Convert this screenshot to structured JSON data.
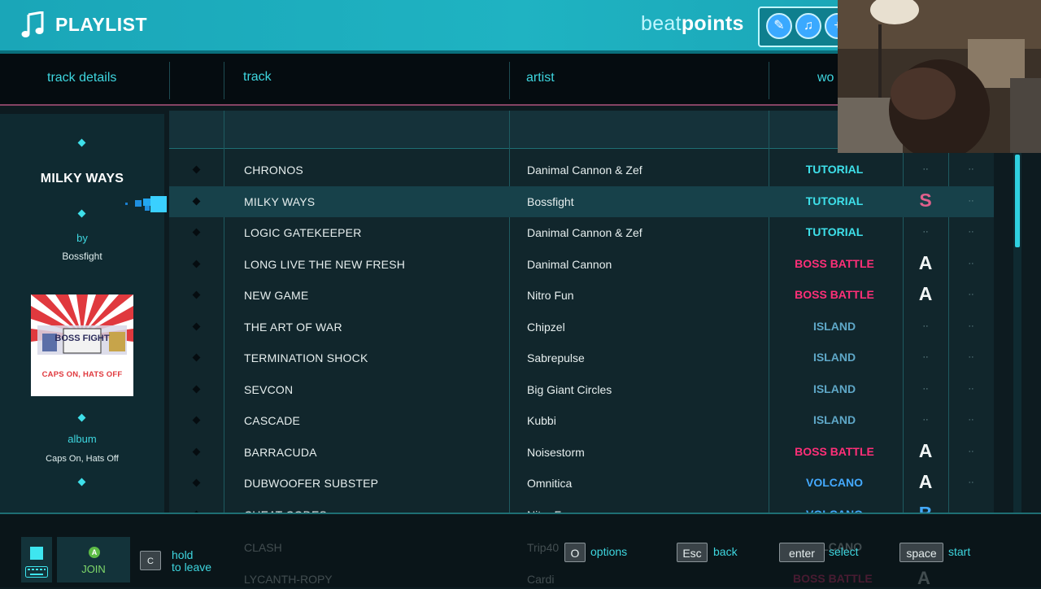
{
  "header": {
    "title": "PLAYLIST",
    "brand_part1": "beat",
    "brand_part2": "points"
  },
  "columns": {
    "track_details": "track details",
    "track": "track",
    "artist": "artist",
    "world": "wo"
  },
  "details": {
    "title": "MILKY WAYS",
    "by_label": "by",
    "artist": "Bossfight",
    "album_label": "album",
    "album": "Caps On, Hats Off",
    "album_art_top": "BOSS FIGHT",
    "album_art_bottom": "CAPS ON, HATS OFF"
  },
  "tracks": [
    {
      "track": "CHRONOS",
      "artist": "Danimal Cannon & Zef",
      "world": "TUTORIAL",
      "world_color": "#3ee0ea",
      "grade": "",
      "selected": false
    },
    {
      "track": "MILKY WAYS",
      "artist": "Bossfight",
      "world": "TUTORIAL",
      "world_color": "#3ee0ea",
      "grade": "S",
      "grade_color": "#e0608c",
      "selected": true
    },
    {
      "track": "LOGIC GATEKEEPER",
      "artist": "Danimal Cannon & Zef",
      "world": "TUTORIAL",
      "world_color": "#3ee0ea",
      "grade": "",
      "selected": false
    },
    {
      "track": "LONG LIVE THE NEW FRESH",
      "artist": "Danimal Cannon",
      "world": "BOSS BATTLE",
      "world_color": "#ff2f78",
      "grade": "A",
      "selected": false
    },
    {
      "track": "NEW GAME",
      "artist": "Nitro Fun",
      "world": "BOSS BATTLE",
      "world_color": "#ff2f78",
      "grade": "A",
      "selected": false
    },
    {
      "track": "THE ART OF WAR",
      "artist": "Chipzel",
      "world": "ISLAND",
      "world_color": "#5fa8c8",
      "grade": "",
      "selected": false
    },
    {
      "track": "TERMINATION SHOCK",
      "artist": "Sabrepulse",
      "world": "ISLAND",
      "world_color": "#5fa8c8",
      "grade": "",
      "selected": false
    },
    {
      "track": "SEVCON",
      "artist": "Big Giant Circles",
      "world": "ISLAND",
      "world_color": "#5fa8c8",
      "grade": "",
      "selected": false
    },
    {
      "track": "CASCADE",
      "artist": "Kubbi",
      "world": "ISLAND",
      "world_color": "#5fa8c8",
      "grade": "",
      "selected": false
    },
    {
      "track": "BARRACUDA",
      "artist": "Noisestorm",
      "world": "BOSS BATTLE",
      "world_color": "#ff2f78",
      "grade": "A",
      "selected": false
    },
    {
      "track": "DUBWOOFER SUBSTEP",
      "artist": "Omnitica",
      "world": "VOLCANO",
      "world_color": "#44aaff",
      "grade": "A",
      "selected": false
    },
    {
      "track": "CHEAT CODES",
      "artist": "Nitro Fun",
      "world": "VOLCANO",
      "world_color": "#44aaff",
      "grade": "B",
      "grade_color": "#44aaff",
      "selected": false
    }
  ],
  "ghost_rows": [
    {
      "track": "CLASH",
      "artist": "Trip40",
      "world": "VOLCANO"
    },
    {
      "track": "LYCANTH-ROPY",
      "artist": "Cardi",
      "world": "BOSS BATTLE",
      "grade": "A"
    }
  ],
  "footer": {
    "join": "JOIN",
    "join_button": "A",
    "leave_key": "C",
    "leave_line1": "hold",
    "leave_line2": "to leave",
    "options_key": "O",
    "options": "options",
    "back_key": "Esc",
    "back": "back",
    "select_key": "enter",
    "select": "select",
    "start_key": "space",
    "start": "start"
  }
}
